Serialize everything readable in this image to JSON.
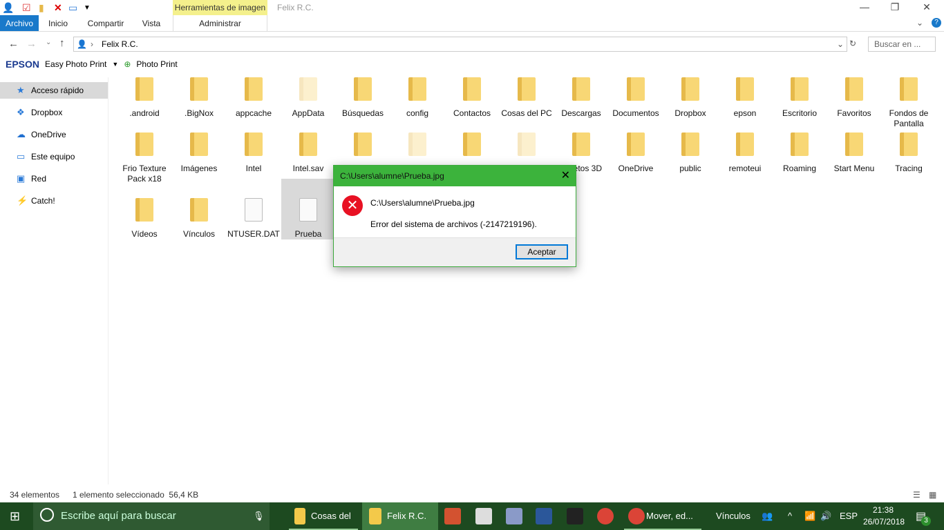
{
  "window": {
    "title": "Felix R.C.",
    "context_tab": "Herramientas de imagen"
  },
  "ribbon": {
    "tabs": [
      "Archivo",
      "Inicio",
      "Compartir",
      "Vista",
      "Administrar"
    ]
  },
  "address": {
    "path": "Felix R.C.",
    "search_placeholder": "Buscar en ..."
  },
  "epson": {
    "brand": "EPSON",
    "app": "Easy Photo Print",
    "photo_print": "Photo Print"
  },
  "nav": [
    "Acceso rápido",
    "Dropbox",
    "OneDrive",
    "Este equipo",
    "Red",
    "Catch!"
  ],
  "items": [
    ".android",
    ".BigNox",
    "appcache",
    "AppData",
    "Búsquedas",
    "config",
    "Contactos",
    "Cosas del PC",
    "Descargas",
    "Documentos",
    "Dropbox",
    "epson",
    "Escritorio",
    "Favoritos",
    "Fondos de Pantalla",
    "Frio Texture Pack x18",
    "Imágenes",
    "Intel",
    "Intel.sav",
    "",
    "",
    "",
    "",
    "Objetos 3D",
    "OneDrive",
    "public",
    "remoteui",
    "Roaming",
    "Start Menu",
    "Tracing",
    "Vídeos",
    "Vínculos",
    "NTUSER.DAT",
    "Prueba"
  ],
  "dialog": {
    "title": "C:\\Users\\alumne\\Prueba.jpg",
    "path": "C:\\Users\\alumne\\Prueba.jpg",
    "message": "Error del sistema de archivos (-2147219196).",
    "ok": "Aceptar"
  },
  "status": {
    "count": "34 elementos",
    "selection": "1 elemento seleccionado  56,4 KB"
  },
  "taskbar": {
    "search": "Escribe aquí para buscar",
    "apps": [
      "Cosas del",
      "Felix R.C.",
      "Mover, ed..."
    ],
    "links": "Vínculos",
    "lang": "ESP",
    "time": "21:38",
    "date": "26/07/2018",
    "notifications": "3"
  },
  "colors": {
    "accent": "#1979ca",
    "dialog_title": "#3cb33c",
    "taskbar": "#1d4a20"
  }
}
